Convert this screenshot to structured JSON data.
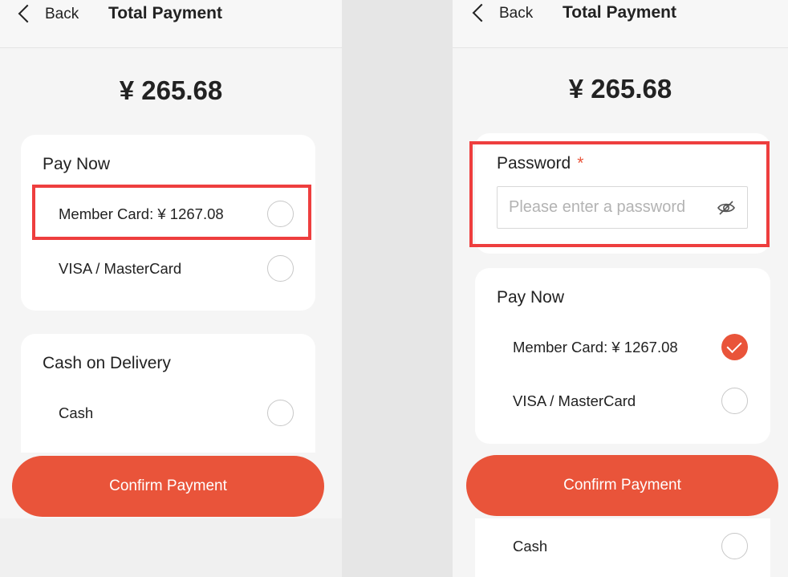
{
  "left_screen": {
    "header": {
      "back_label": "Back",
      "title": "Total Payment"
    },
    "amount": "¥ 265.68",
    "pay_now": {
      "title": "Pay Now",
      "options": [
        {
          "label": "Member Card: ¥ 1267.08",
          "selected": false
        },
        {
          "label": "VISA / MasterCard",
          "selected": false
        }
      ]
    },
    "cash_on_delivery": {
      "title": "Cash on Delivery",
      "options": [
        {
          "label": "Cash",
          "selected": false
        }
      ]
    },
    "confirm_label": "Confirm Payment"
  },
  "right_screen": {
    "header": {
      "back_label": "Back",
      "title": "Total Payment"
    },
    "amount": "¥ 265.68",
    "password": {
      "label": "Password",
      "required_mark": "*",
      "placeholder": "Please enter a password",
      "value": ""
    },
    "pay_now": {
      "title": "Pay Now",
      "options": [
        {
          "label": "Member Card: ¥ 1267.08",
          "selected": true
        },
        {
          "label": "VISA / MasterCard",
          "selected": false
        }
      ]
    },
    "cash_on_delivery": {
      "options": [
        {
          "label": "Cash",
          "selected": false
        }
      ]
    },
    "confirm_label": "Confirm Payment"
  },
  "colors": {
    "accent": "#e9543a",
    "highlight_border": "#ee3e3e",
    "background": "#f5f5f5",
    "card": "#ffffff"
  }
}
